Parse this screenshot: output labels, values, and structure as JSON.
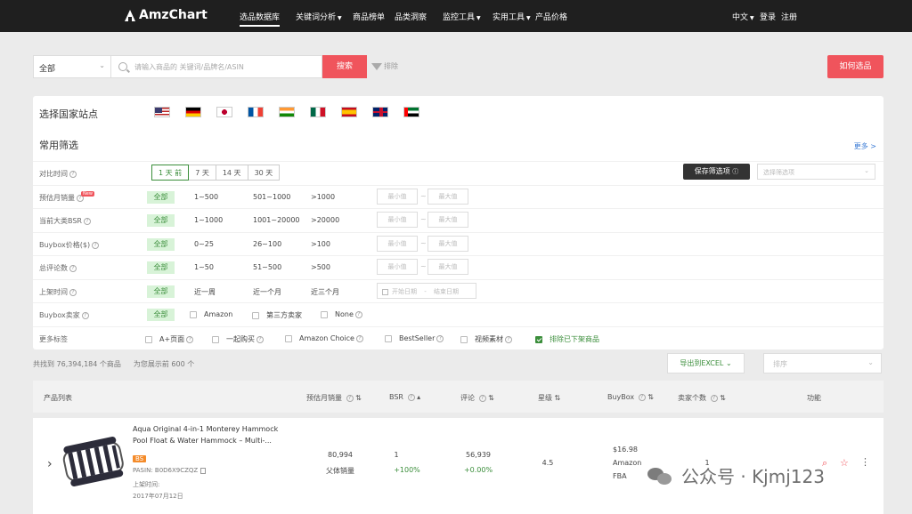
{
  "brand": "AmzChart",
  "nav": {
    "items": [
      {
        "label": "选品数据库",
        "dropdown": false,
        "active": true
      },
      {
        "label": "关键词分析",
        "dropdown": true,
        "active": false
      },
      {
        "label": "商品榜单",
        "dropdown": false,
        "active": false
      },
      {
        "label": "品类洞察",
        "dropdown": false,
        "active": false
      },
      {
        "label": "监控工具",
        "dropdown": true,
        "active": false
      },
      {
        "label": "实用工具",
        "dropdown": true,
        "active": false
      },
      {
        "label": "产品价格",
        "dropdown": false,
        "active": false
      }
    ],
    "language": "中文",
    "login": "登录",
    "register": "注册"
  },
  "search": {
    "category_value": "全部",
    "placeholder": "请输入商品的 关键词/品牌名/ASIN",
    "button": "搜索",
    "exclude": "排除",
    "how_to": "如何选品"
  },
  "panel": {
    "site_label": "选择国家站点",
    "flags": [
      "us-flag",
      "de-flag",
      "jp-flag",
      "fr-flag",
      "in-flag",
      "mx-flag",
      "es-flag",
      "uk-flag",
      "ae-flag"
    ],
    "common_label": "常用筛选",
    "more": "更多 >",
    "compare": {
      "label": "对比时间",
      "options": [
        "1 天 前",
        "7 天",
        "14 天",
        "30 天"
      ],
      "selected": 0,
      "save": "保存筛选项",
      "choose_placeholder": "选择筛选项"
    },
    "rows": [
      {
        "label": "预估月销量",
        "badge": "New",
        "all": "全部",
        "opts": [
          "1~500",
          "501~1000",
          ">1000"
        ],
        "min": "最小值",
        "max": "最大值"
      },
      {
        "label": "当前大类BSR",
        "all": "全部",
        "opts": [
          "1~1000",
          "1001~20000",
          ">20000"
        ],
        "min": "最小值",
        "max": "最大值"
      },
      {
        "label": "Buybox价格($)",
        "all": "全部",
        "opts": [
          "0~25",
          "26~100",
          ">100"
        ],
        "min": "最小值",
        "max": "最大值"
      },
      {
        "label": "总评论数",
        "all": "全部",
        "opts": [
          "1~50",
          "51~500",
          ">500"
        ],
        "min": "最小值",
        "max": "最大值"
      }
    ],
    "listed": {
      "label": "上架时间",
      "all": "全部",
      "opts": [
        "近一周",
        "近一个月",
        "近三个月"
      ],
      "start": "开始日期",
      "sep": "-",
      "end": "结束日期"
    },
    "seller": {
      "label": "Buybox卖家",
      "all": "全部",
      "opts": [
        "Amazon",
        "第三方卖家",
        "None"
      ]
    },
    "tags": {
      "label": "更多标签",
      "opts": [
        "A+页面",
        "一起购买",
        "Amazon Choice",
        "BestSeller",
        "视频素材",
        "排除已下架商品"
      ],
      "checked": [
        false,
        false,
        false,
        false,
        false,
        true
      ]
    }
  },
  "results": {
    "total": "共找到 76,394,184 个商品",
    "shown": "为您展示前 600 个",
    "export": "导出到EXCEL",
    "sort_placeholder": "排序"
  },
  "table": {
    "headers": {
      "product": "产品列表",
      "sales": "预估月销量",
      "bsr": "BSR",
      "reviews": "评论",
      "rating": "星级",
      "buybox": "BuyBox",
      "sellers": "卖家个数",
      "actions": "功能"
    },
    "rows": [
      {
        "title": "Aqua Original 4-in-1 Monterey Hammock Pool Float & Water Hammock – Multi-...",
        "badge": "BS",
        "asin": "PASIN: B0D6X9CZQZ",
        "listed_label": "上架时间:",
        "listed_date": "2017年07月12日",
        "sales": "80,994",
        "sales_sub": "父体销量",
        "bsr": "1",
        "bsr_change": "+100%",
        "reviews": "56,939",
        "reviews_change": "+0.00%",
        "rating": "4.5",
        "price": "$16.98",
        "seller": "Amazon",
        "fulfillment": "FBA",
        "seller_count": "1"
      }
    ]
  },
  "watermark": "公众号 · Kjmj123"
}
